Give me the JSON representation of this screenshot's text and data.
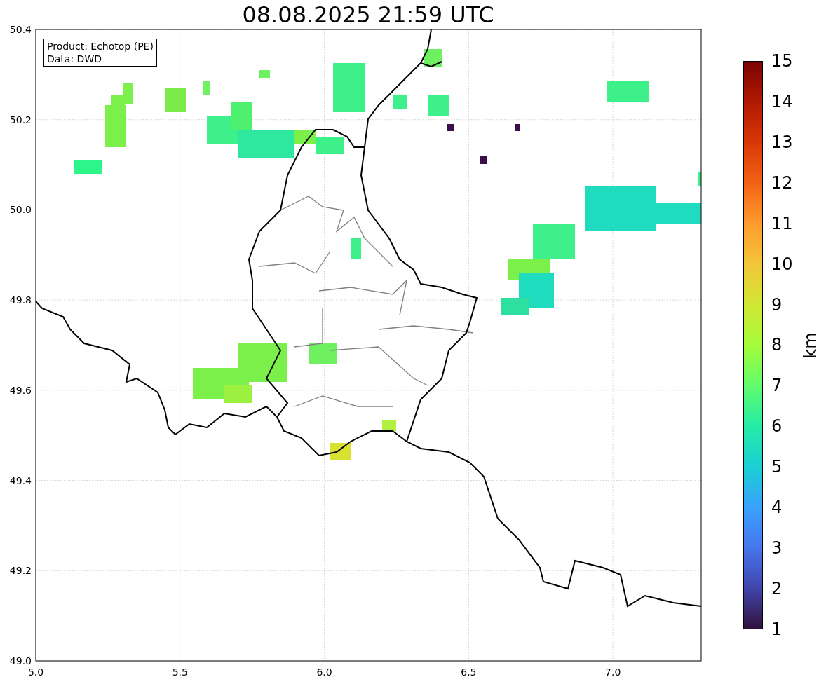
{
  "title": "08.08.2025 21:59 UTC",
  "legend": {
    "lines": [
      "Product: Echotop (PE)",
      "Data: DWD"
    ]
  },
  "x_axis": {
    "ticks": [
      "5.0",
      "5.5",
      "6.0",
      "6.5",
      "7.0"
    ]
  },
  "y_axis": {
    "ticks": [
      "50.4",
      "50.2",
      "50.0",
      "49.8",
      "49.6",
      "49.4",
      "49.2",
      "49.0"
    ]
  },
  "colorbar": {
    "label": "km",
    "ticks": [
      "15",
      "14",
      "13",
      "12",
      "11",
      "10",
      "9",
      "8",
      "7",
      "6",
      "5",
      "4",
      "3",
      "2",
      "1"
    ]
  }
}
